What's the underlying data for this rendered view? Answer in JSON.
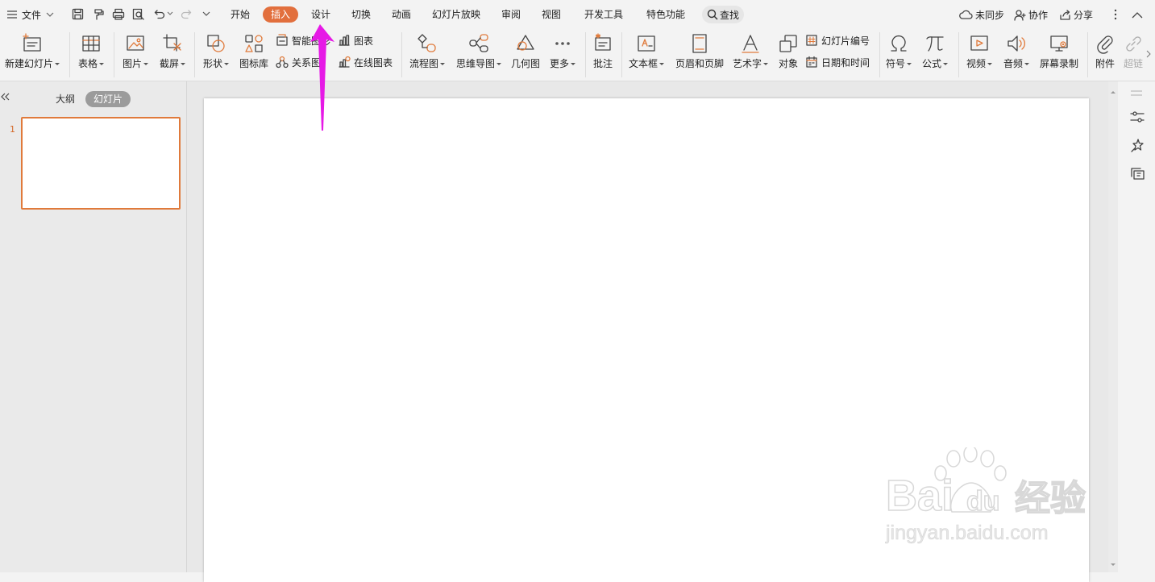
{
  "titlebar": {
    "file_menu": "文件",
    "tabs": [
      {
        "label": "开始"
      },
      {
        "label": "插入",
        "active": true
      },
      {
        "label": "设计"
      },
      {
        "label": "切换"
      },
      {
        "label": "动画"
      },
      {
        "label": "幻灯片放映"
      },
      {
        "label": "审阅"
      },
      {
        "label": "视图"
      },
      {
        "label": "开发工具"
      },
      {
        "label": "特色功能"
      }
    ],
    "search_label": "查找",
    "sync_label": "未同步",
    "collab_label": "协作",
    "share_label": "分享"
  },
  "ribbon": {
    "new_slide": "新建幻灯片",
    "table": "表格",
    "picture": "图片",
    "screenshot": "截屏",
    "shape": "形状",
    "icon_library": "图标库",
    "smart_art": "智能图形",
    "relation_chart": "关系图",
    "chart": "图表",
    "online_chart": "在线图表",
    "flowchart": "流程图",
    "mindmap": "思维导图",
    "geometry": "几何图",
    "more": "更多",
    "comment": "批注",
    "textbox": "文本框",
    "header_footer": "页眉和页脚",
    "wordart": "艺术字",
    "object": "对象",
    "slide_number": "幻灯片编号",
    "date_time": "日期和时间",
    "symbol": "符号",
    "formula": "公式",
    "video": "视频",
    "audio": "音频",
    "screen_record": "屏幕录制",
    "attachment": "附件",
    "hyperlink": "超链"
  },
  "left_panel": {
    "tab_outline": "大纲",
    "tab_slides": "幻灯片",
    "slide_number": "1"
  },
  "watermark": {
    "brand": "Bai",
    "brand_suffix": "经验",
    "url": "jingyan.baidu.com"
  },
  "colors": {
    "accent": "#e26f3d",
    "annotation_arrow": "#e619e6"
  }
}
